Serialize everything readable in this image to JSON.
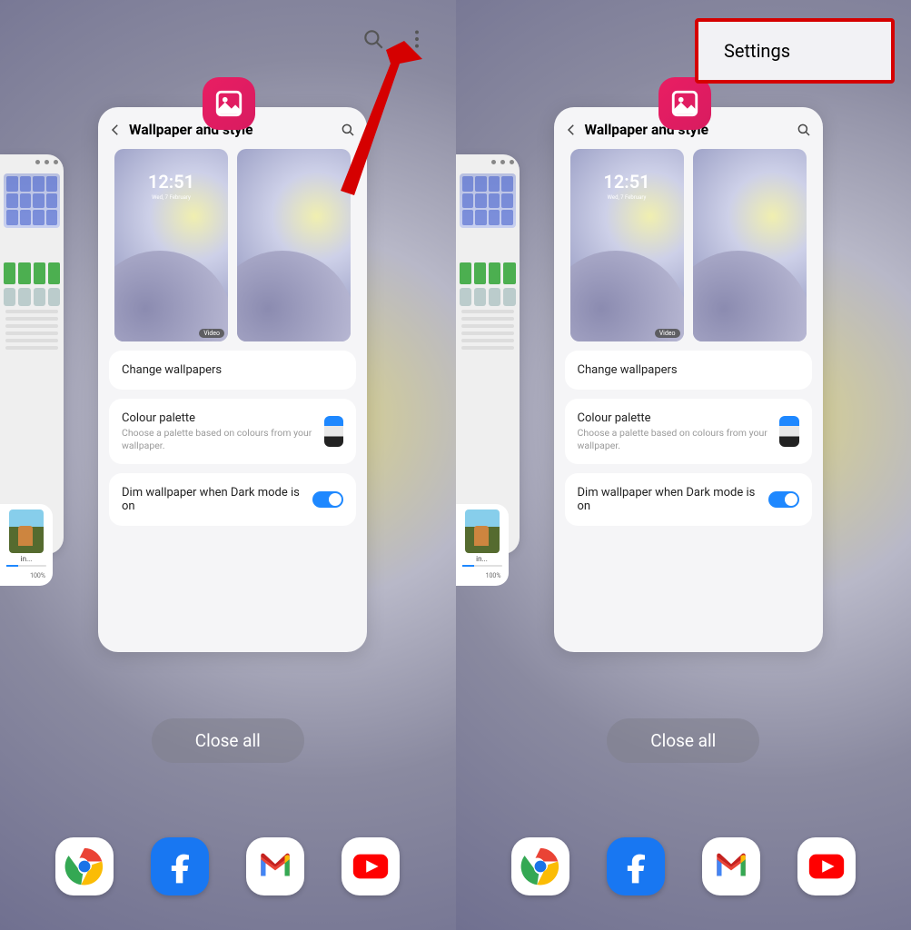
{
  "top": {
    "menu_label": "Settings"
  },
  "card": {
    "title": "Wallpaper and style",
    "lock_time": "12:51",
    "lock_date": "Wed, 7 February",
    "video_badge": "Video",
    "change_wallpapers": "Change wallpapers",
    "colour_palette_title": "Colour palette",
    "colour_palette_sub": "Choose a palette based on colours from your wallpaper.",
    "dim_label": "Dim wallpaper when Dark mode is on"
  },
  "peek": {
    "label": "in...",
    "percent": "100%"
  },
  "close_all": "Close all",
  "dock": {
    "chrome": "chrome-icon",
    "facebook": "facebook-icon",
    "gmail": "gmail-icon",
    "youtube": "youtube-icon"
  }
}
